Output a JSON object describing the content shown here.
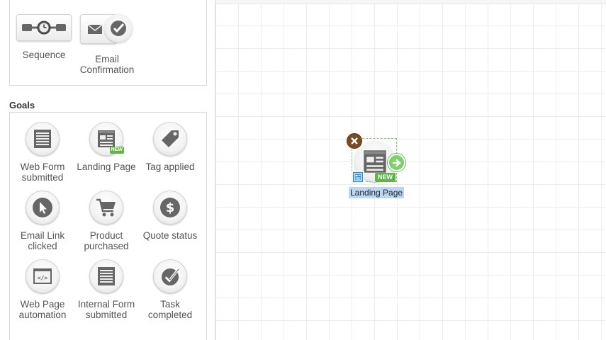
{
  "sidebar": {
    "actions": [
      {
        "label": "Sequence",
        "icon": "sequence-icon"
      },
      {
        "label": "Email\nConfirmation",
        "icon": "email-confirmation-icon"
      }
    ],
    "goals_heading": "Goals",
    "goals": [
      {
        "label": "Web Form submitted",
        "icon": "web-form-icon",
        "new": false
      },
      {
        "label": "Landing Page",
        "icon": "landing-page-icon",
        "new": true
      },
      {
        "label": "Tag applied",
        "icon": "tag-icon",
        "new": false
      },
      {
        "label": "Email Link clicked",
        "icon": "cursor-icon",
        "new": false
      },
      {
        "label": "Product purchased",
        "icon": "cart-icon",
        "new": false
      },
      {
        "label": "Quote status",
        "icon": "dollar-icon",
        "new": false
      },
      {
        "label": "Web Page automation",
        "icon": "code-icon",
        "new": false
      },
      {
        "label": "Internal Form submitted",
        "icon": "internal-form-icon",
        "new": false
      },
      {
        "label": "Task completed",
        "icon": "checkmark-icon",
        "new": false
      }
    ],
    "new_badge": "NEW"
  },
  "canvas": {
    "node": {
      "label": "Landing Page",
      "badge": "NEW",
      "icon": "landing-page-icon"
    }
  },
  "colors": {
    "new_green": "#5fb447",
    "close_brown": "#7a4a20",
    "arrow_green": "#7fcf6b",
    "form_blue": "#2f8fd4",
    "selection_blue": "#bcd6f0"
  }
}
